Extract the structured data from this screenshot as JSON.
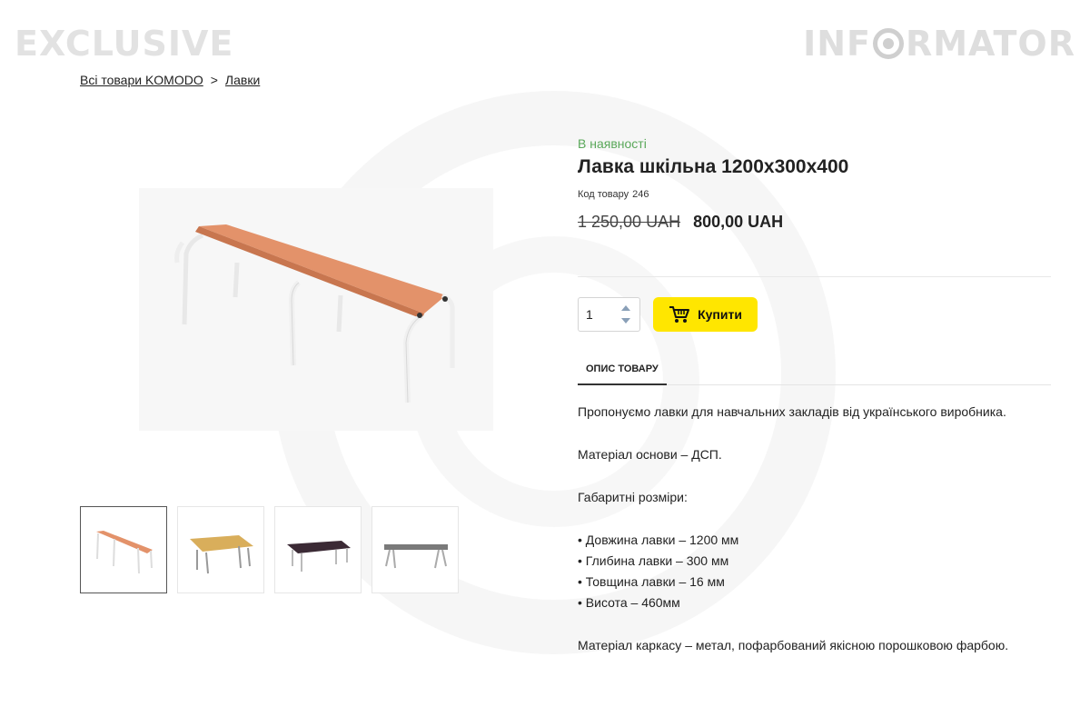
{
  "watermark": {
    "left_text": "EXCLUSIVE",
    "right_text_a": "INF",
    "right_text_b": "RMATOR"
  },
  "breadcrumb": {
    "item1": "Всі товари KOMODO",
    "sep": ">",
    "item2": "Лавки"
  },
  "product": {
    "stock": "В наявності",
    "title": "Лавка шкільна 1200х300х400",
    "sku_label": "Код товару",
    "sku_value": "246",
    "old_price": "1 250,00  UAH",
    "new_price": "800,00  UAH",
    "quantity": "1",
    "buy_label": "Купити"
  },
  "tabs": {
    "description": "ОПИС ТОВАРУ"
  },
  "description": {
    "p1": "Пропонуємо лавки для навчальних закладів від українського виробника.",
    "p2": "Матеріал основи – ДСП.",
    "p3": "Габаритні розміри:",
    "bullets": [
      "• Довжина лавки – 1200 мм",
      "• Глибина лавки – 300 мм",
      "• Товщина лавки – 16 мм",
      "• Висота – 460мм"
    ],
    "p4": "Матеріал каркасу – метал, пофарбований якісною порошковою фарбою."
  },
  "colors": {
    "accent": "#ffe600",
    "stock": "#5aa85a",
    "bench_top": "#e3926a",
    "frame": "#f2f2f2"
  }
}
